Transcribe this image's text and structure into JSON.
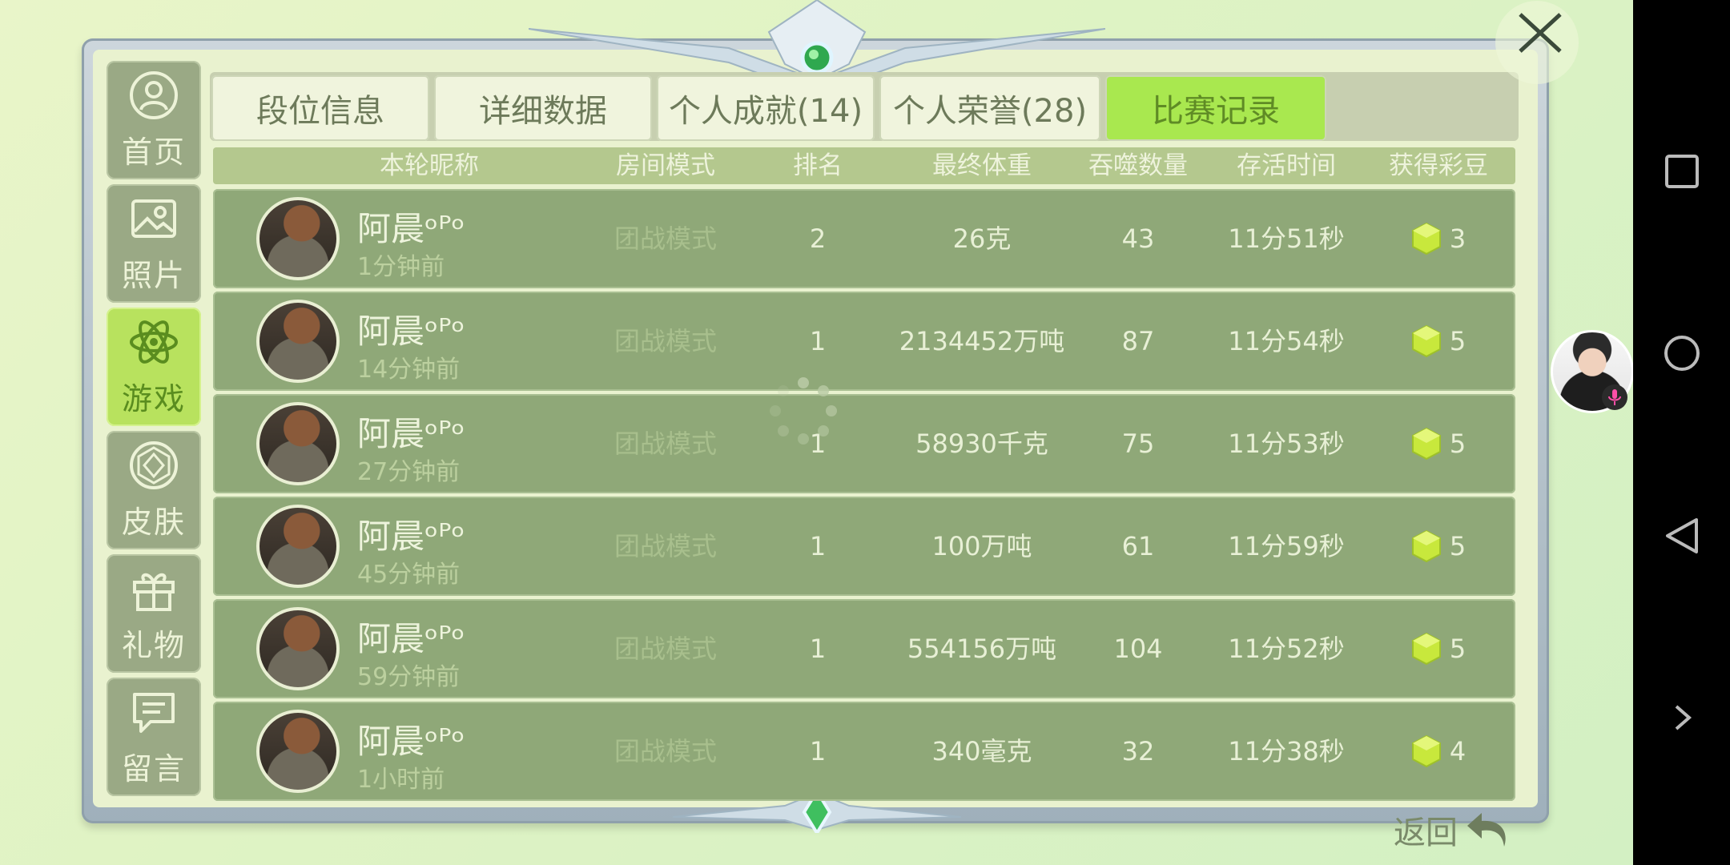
{
  "side_nav": [
    {
      "label": "首页",
      "icon": "home-user-icon",
      "active": false
    },
    {
      "label": "照片",
      "icon": "photo-icon",
      "active": false
    },
    {
      "label": "游戏",
      "icon": "atom-icon",
      "active": true
    },
    {
      "label": "皮肤",
      "icon": "diamond-icon",
      "active": false
    },
    {
      "label": "礼物",
      "icon": "gift-icon",
      "active": false
    },
    {
      "label": "留言",
      "icon": "message-icon",
      "active": false
    }
  ],
  "tabs": [
    {
      "label": "段位信息",
      "active": false
    },
    {
      "label": "详细数据",
      "active": false
    },
    {
      "label": "个人成就(14)",
      "active": false
    },
    {
      "label": "个人荣誉(28)",
      "active": false
    },
    {
      "label": "比赛记录",
      "active": true
    }
  ],
  "table": {
    "headers": [
      "本轮昵称",
      "房间模式",
      "排名",
      "最终体重",
      "吞噬数量",
      "存活时间",
      "获得彩豆"
    ],
    "rows": [
      {
        "nick": "阿晨ᵒᴾᵒ",
        "time": "1分钟前",
        "mode": "团战模式",
        "rank": "2",
        "weight": "26克",
        "eaten": "43",
        "survival": "11分51秒",
        "beans": "3"
      },
      {
        "nick": "阿晨ᵒᴾᵒ",
        "time": "14分钟前",
        "mode": "团战模式",
        "rank": "1",
        "weight": "2134452万吨",
        "eaten": "87",
        "survival": "11分54秒",
        "beans": "5"
      },
      {
        "nick": "阿晨ᵒᴾᵒ",
        "time": "27分钟前",
        "mode": "团战模式",
        "rank": "1",
        "weight": "58930千克",
        "eaten": "75",
        "survival": "11分53秒",
        "beans": "5"
      },
      {
        "nick": "阿晨ᵒᴾᵒ",
        "time": "45分钟前",
        "mode": "团战模式",
        "rank": "1",
        "weight": "100万吨",
        "eaten": "61",
        "survival": "11分59秒",
        "beans": "5"
      },
      {
        "nick": "阿晨ᵒᴾᵒ",
        "time": "59分钟前",
        "mode": "团战模式",
        "rank": "1",
        "weight": "554156万吨",
        "eaten": "104",
        "survival": "11分52秒",
        "beans": "5"
      },
      {
        "nick": "阿晨ᵒᴾᵒ",
        "time": "1小时前",
        "mode": "团战模式",
        "rank": "1",
        "weight": "340毫克",
        "eaten": "32",
        "survival": "11分38秒",
        "beans": "4"
      }
    ]
  },
  "back_label": "返回",
  "colors": {
    "accent": "#a9e84f",
    "row": "#8fa878",
    "bean": "#c8e83c"
  }
}
